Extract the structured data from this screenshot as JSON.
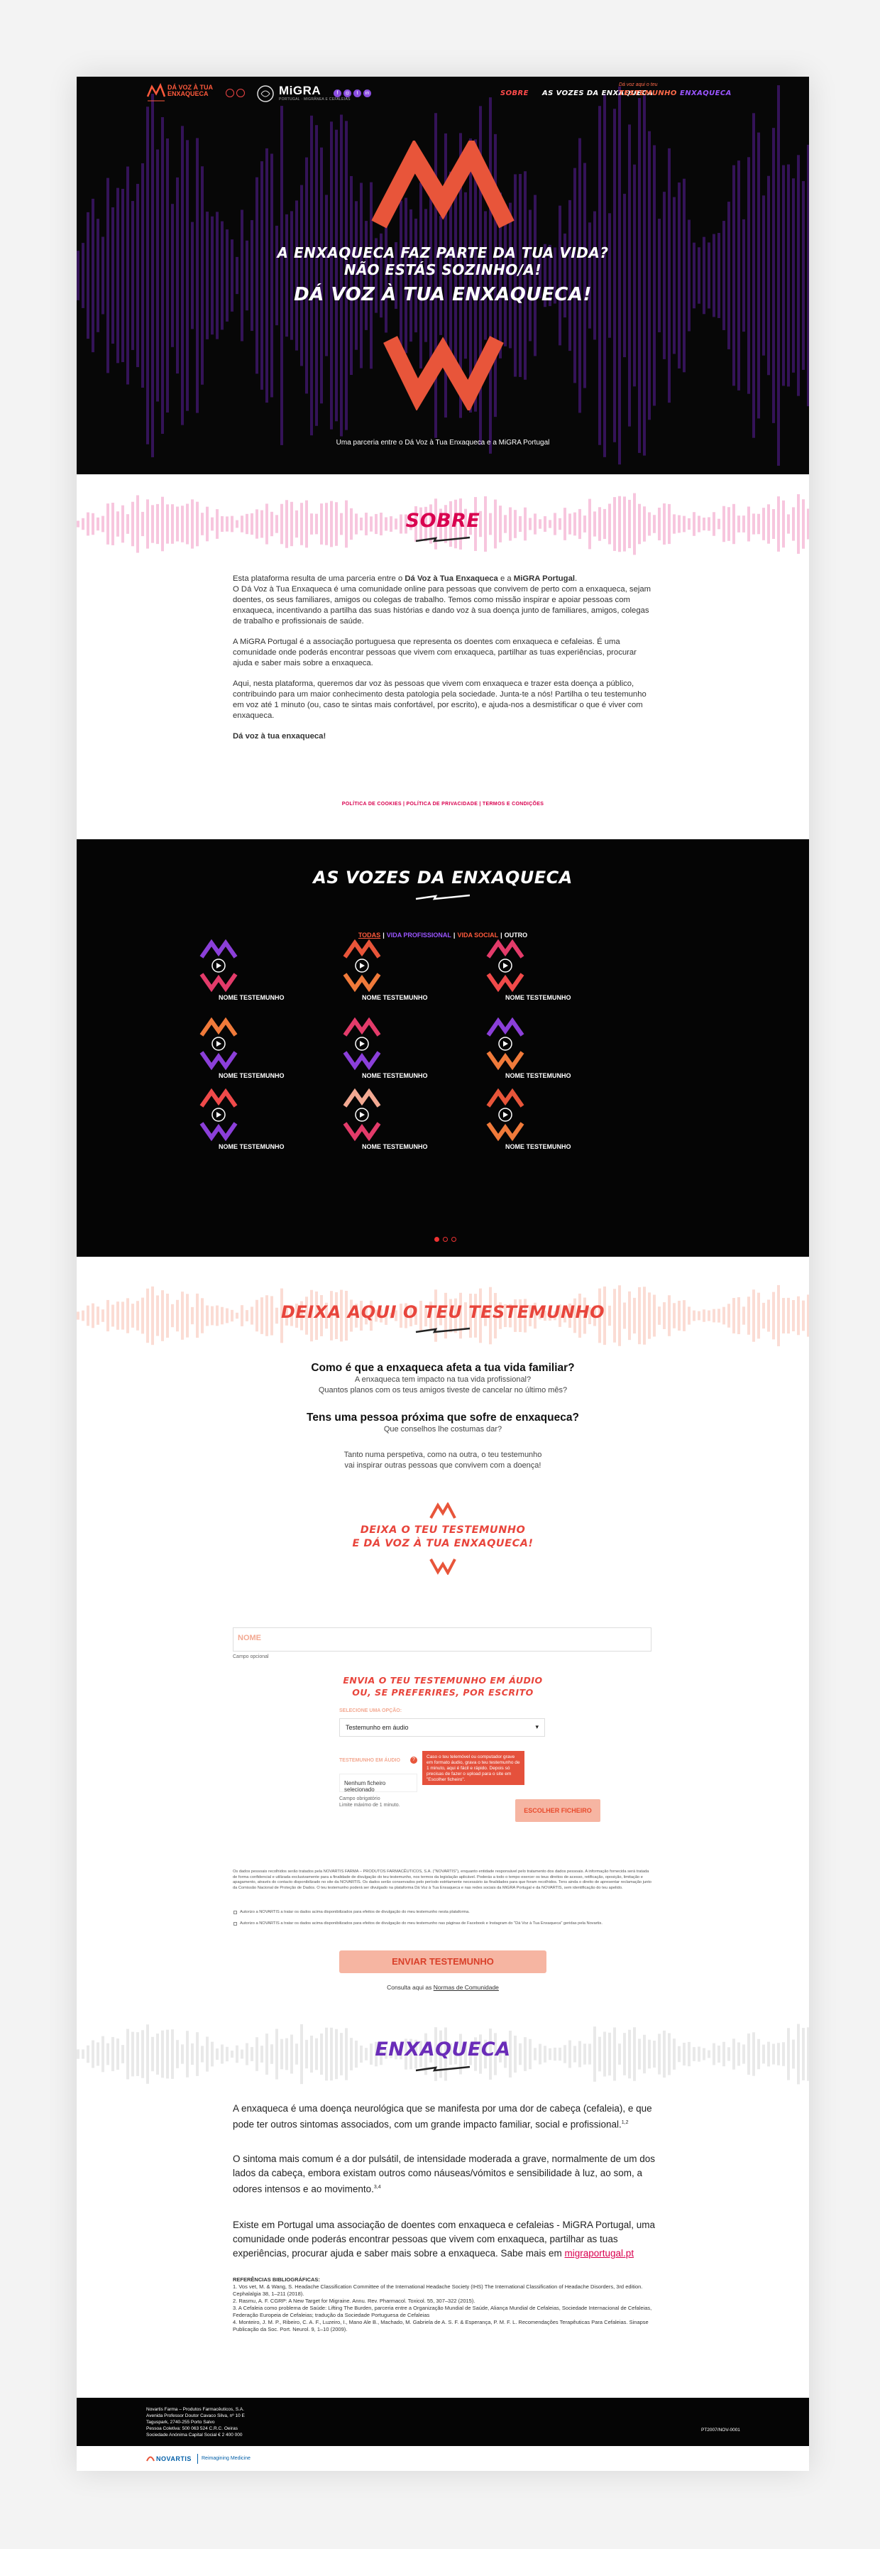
{
  "nav": {
    "brand_line1": "DÁ VOZ À TUA",
    "brand_line2": "ENXAQUECA",
    "partner_logo": "MiGRA",
    "partner_sub": "PORTUGAL · MIGRÂNEA E CEFALEIAS",
    "social_icons": [
      "facebook-icon",
      "instagram-icon",
      "twitter-icon",
      "linkedin-icon"
    ],
    "links": [
      "SOBRE",
      "AS VOZES DA ENXAQUECA",
      "TESTEMUNHO",
      "ENXAQUECA"
    ],
    "testemunho_kicker": "Dá voz aqui o teu"
  },
  "hero": {
    "line1": "A ENXAQUECA FAZ PARTE DA TUA VIDA?",
    "line2": "NÃO ESTÁS SOZINHO/A!",
    "line3": "DÁ VOZ À TUA ENXAQUECA!",
    "partnership": "Uma parceria entre o Dá Voz à Tua Enxaqueca e a MiGRA Portugal"
  },
  "sobre": {
    "title": "SOBRE",
    "p1_a": "Esta plataforma resulta de uma parceria entre o ",
    "p1_b": "Dá Voz à Tua Enxaqueca",
    "p1_c": " e a ",
    "p1_d": "MiGRA Portugal",
    "p1_e": ".",
    "p2": "O Dá Voz à Tua Enxaqueca é uma comunidade online para pessoas que convivem de perto com a enxaqueca, sejam doentes, os seus familiares, amigos ou colegas de trabalho. Temos como missão inspirar e apoiar pessoas com enxaqueca, incentivando a partilha das suas histórias e dando voz à sua doença junto de familiares, amigos, colegas de trabalho e profissionais de saúde.",
    "p3": "A MiGRA Portugal é a associação portuguesa que representa os doentes com enxaqueca e cefaleias. É uma comunidade onde poderás encontrar pessoas que vivem com enxaqueca, partilhar as tuas experiências, procurar ajuda e saber mais sobre a enxaqueca.",
    "p4": "Aqui, nesta plataforma, queremos dar voz às pessoas que vivem com enxaqueca e trazer esta doença a público, contribuindo para um maior conhecimento desta patologia pela sociedade. Junta-te a nós! Partilha o teu testemunho em voz até 1 minuto (ou, caso te sintas mais confortável, por escrito), e ajuda-nos a desmistificar o que é viver com enxaqueca.",
    "p5": "Dá voz à tua enxaqueca!",
    "policy_links": "POLÍTICA DE COOKIES | POLÍTICA DE PRIVACIDADE | TERMOS E CONDIÇÕES"
  },
  "vozes": {
    "title": "AS VOZES DA ENXAQUECA",
    "filters": [
      "TODAS",
      "VIDA PROFISSIONAL",
      "VIDA SOCIAL",
      "OUTRO"
    ],
    "cards": [
      {
        "name": "NOME TESTEMUNHO",
        "color": "#8b3fd9",
        "color2": "#e33b6a"
      },
      {
        "name": "NOME TESTEMUNHO",
        "color": "#e8553a",
        "color2": "#f07a3a"
      },
      {
        "name": "NOME TESTEMUNHO",
        "color": "#e33b6a",
        "color2": "#f04a4a"
      },
      {
        "name": "NOME TESTEMUNHO",
        "color": "#f07a3a",
        "color2": "#8b3fd9"
      },
      {
        "name": "NOME TESTEMUNHO",
        "color": "#e33b6a",
        "color2": "#8b3fd9"
      },
      {
        "name": "NOME TESTEMUNHO",
        "color": "#8b3fd9",
        "color2": "#f07a3a"
      },
      {
        "name": "NOME TESTEMUNHO",
        "color": "#f04a4a",
        "color2": "#8b3fd9"
      },
      {
        "name": "NOME TESTEMUNHO",
        "color": "#f3a992",
        "color2": "#e33b6a"
      },
      {
        "name": "NOME TESTEMUNHO",
        "color": "#e8553a",
        "color2": "#f07a3a"
      }
    ]
  },
  "testemunho": {
    "title": "DEIXA AQUI O TEU TESTEMUNHO",
    "q1": "Como é que a enxaqueca afeta a tua vida familiar?",
    "q1_s1": "A enxaqueca tem impacto na tua vida profissional?",
    "q1_s2": "Quantos planos com os teus amigos tiveste de cancelar no último mês?",
    "q2": "Tens uma pessoa próxima que sofre de enxaqueca?",
    "q2_s1": "Que conselhos lhe costumas dar?",
    "q3_s1": "Tanto numa perspetiva, como na outra, o teu testemunho",
    "q3_s2": "vai inspirar outras pessoas que convivem com a doença!",
    "cta1": "DEIXA O TEU TESTEMUNHO",
    "cta2": "E DÁ VOZ À TUA ENXAQUECA!",
    "name_placeholder": "NOME",
    "required": "Campo opcional",
    "audio_title1": "ENVIA O TEU TESTEMUNHO EM ÁUDIO",
    "audio_title2": "OU, SE PREFERIRES, POR ESCRITO",
    "select_label": "SELECIONE UMA OPÇÃO:",
    "select_value": "Testemunho em áudio",
    "upload_label": "TESTEMUNHO EM ÁUDIO",
    "file_status": "Nenhum ficheiro selecionado",
    "file_req1": "Campo obrigatório",
    "file_req2": "Limite máximo de 1 minuto.",
    "tooltip": "Caso o teu telemóvel ou computador grave em formato áudio, grava o teu testemunho de 1 minuto, aqui é fácil e rápido. Depois só precisas de fazer o upload para o site em \"Escolher ficheiro\".",
    "file_button": "ESCOLHER FICHEIRO",
    "legal": "Os dados pessoais recolhidos serão tratados pela NOVARTIS FARMA – PRODUTOS FARMACÊUTICOS, S.A. (\"NOVARTIS\"), enquanto entidade responsável pelo tratamento dos dados pessoais. A informação fornecida será tratada de forma confidencial e utilizada exclusivamente para a finalidade de divulgação do teu testemunho, nos termos da legislação aplicável. Poderás a todo o tempo exercer os teus direitos de acesso, retificação, oposição, limitação e apagamento, através do contacto disponibilizado no site da NOVARTIS. Os dados serão conservados pelo período estritamente necessário às finalidades para que foram recolhidos. Tens ainda o direito de apresentar reclamação junto da Comissão Nacional de Proteção de Dados. O teu testemunho poderá ser divulgado na plataforma Dá Voz à Tua Enxaqueca e nas redes sociais da MiGRA Portugal e da NOVARTIS, sem identificação do teu apelido.",
    "check1": "Autorizo a NOVARTIS a tratar os dados acima disponibilizados para efeitos de divulgação do meu testemunho nesta plataforma.",
    "check2": "Autorizo a NOVARTIS a tratar os dados acima disponibilizados para efeitos de divulgação do meu testemunho nas páginas de Facebook e Instagram do \"Dá Voz à Tua Enxaqueca\" geridas pela Novartis.",
    "send_button": "ENVIAR TESTEMUNHO",
    "norms_prefix": "Consulta aqui as ",
    "norms_link": "Normas de Comunidade"
  },
  "enxaqueca": {
    "title": "ENXAQUECA",
    "p1": "A enxaqueca é uma doença neurológica que se manifesta por uma dor de cabeça (cefaleia), e que pode ter outros sintomas associados, com um grande impacto familiar, social e profissional.",
    "p1_sup": "1,2",
    "p2": "O sintoma mais comum é a dor pulsátil, de intensidade moderada a grave, normalmente de um dos lados da cabeça, embora existam outros como náuseas/vómitos e sensibilidade à luz, ao som, a odores intensos e ao movimento.",
    "p2_sup": "3,4",
    "p3": "Existe em Portugal uma associação de doentes com enxaqueca e cefaleias - MiGRA Portugal, uma comunidade onde poderás encontrar pessoas que vivem com enxaqueca, partilhar as tuas experiências, procurar ajuda e saber mais sobre a enxaqueca. Sabe mais em ",
    "p3_link": "migraportugal.pt",
    "refs_title": "REFERÊNCIAS BIBLIOGRÁFICAS:",
    "refs": [
      "1. Vos vet, M. & Wang, S. Headache Classification Committee of the International Headache Society (IHS) The International Classification of Headache Disorders, 3rd edition. Cephalalgia 38, 1–211 (2018).",
      "2. Rasmu, A. F. CGRP: A New Target for Migraine. Annu. Rev. Pharmacol. Toxicol. 55, 307–322 (2015).",
      "3. A Cefaleia como problema de Saúde: Lifting The Burden, parceria entre a Organização Mundial de Saúde, Aliança Mundial de Cefaleias, Sociedade Internacional de Cefaleias, Federação Europeia de Cefaleias; tradução da Sociedade Portuguesa de Cefaleias",
      "4. Monteiro, J. M. P., Ribeiro, C. A. F., Luzeiro, I., Mano Ale B., Machado, M. Gabriela de A. S. F. & Esperança, P. M. F. L. Recomendações Terapêuticas Para Cefaleias. Sinapse Publicação da Soc. Port. Neurol. 9, 1–10 (2009)."
    ]
  },
  "footer": {
    "lines": [
      "Novartis Farma – Produtos Farmacêuticos, S.A.",
      "Avenida Professor Doutor Cavaco Silva, nº 10 E",
      "Taguspark, 2740-255 Porto Salvo",
      "Pessoa Coletiva: 500 063 524 C.R.C. Oeiras",
      "Sociedade Anónima Capital Social € 2 400 000"
    ],
    "code": "PT2007/NOV-0001",
    "novartis": "NOVARTIS",
    "tagline": "Reimagining Medicine"
  },
  "colors": {
    "red": "#e8553a",
    "pink": "#d9004f",
    "purple": "#7a2fd0",
    "orange": "#f07a3a"
  }
}
